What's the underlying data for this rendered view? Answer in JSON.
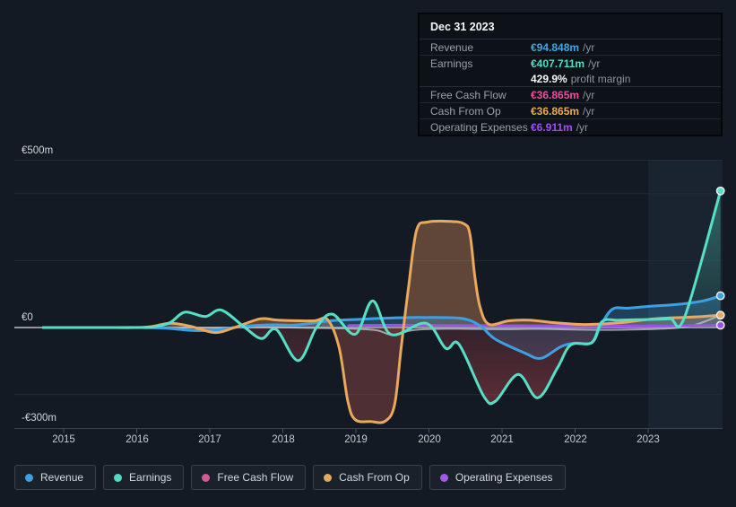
{
  "tooltip": {
    "date": "Dec 31 2023",
    "revenue": {
      "label": "Revenue",
      "value": "€94.848m",
      "suffix": "/yr"
    },
    "earnings": {
      "label": "Earnings",
      "value": "€407.711m",
      "suffix": "/yr"
    },
    "margin": {
      "value": "429.9%",
      "suffix": "profit margin"
    },
    "fcf": {
      "label": "Free Cash Flow",
      "value": "€36.865m",
      "suffix": "/yr"
    },
    "cfo": {
      "label": "Cash From Op",
      "value": "€36.865m",
      "suffix": "/yr"
    },
    "opex": {
      "label": "Operating Expenses",
      "value": "€6.911m",
      "suffix": "/yr"
    }
  },
  "legend": {
    "items": [
      {
        "label": "Revenue",
        "color": "#3da0e3"
      },
      {
        "label": "Earnings",
        "color": "#4fdcc2"
      },
      {
        "label": "Free Cash Flow",
        "color": "#cf5a95"
      },
      {
        "label": "Cash From Op",
        "color": "#e3a95e"
      },
      {
        "label": "Operating Expenses",
        "color": "#a259e8"
      }
    ]
  },
  "chart_data": {
    "type": "line",
    "unit": "EUR millions per year",
    "x_ticks": [
      2015,
      2016,
      2017,
      2018,
      2019,
      2020,
      2021,
      2022,
      2023
    ],
    "ylim": [
      -300,
      500
    ],
    "y_ticks": [
      {
        "label": "€500m",
        "value": 500
      },
      {
        "label": "€0",
        "value": 0
      },
      {
        "label": "-€300m",
        "value": -300
      }
    ],
    "gridline_values": [
      500,
      400,
      200,
      -200
    ],
    "highlight_from": 2023,
    "colors": {
      "zero_line": "#8f969e",
      "gridline": "#232b36",
      "axis": "#3a434f",
      "tick": "#49525f",
      "highlight_band": "#1d2a38",
      "dot_stroke": "#edf0f2"
    },
    "series": [
      {
        "name": "Revenue",
        "color": "#3da0e3",
        "kind": "revenue",
        "end_dot": true,
        "points": [
          [
            2014.72,
            0
          ],
          [
            2015.5,
            0
          ],
          [
            2016.1,
            0
          ],
          [
            2016.46,
            -3
          ],
          [
            2016.78,
            -9
          ],
          [
            2017.1,
            -7
          ],
          [
            2017.4,
            2
          ],
          [
            2017.7,
            7
          ],
          [
            2017.93,
            8
          ],
          [
            2018.2,
            8
          ],
          [
            2018.64,
            20
          ],
          [
            2019.0,
            24
          ],
          [
            2019.4,
            28
          ],
          [
            2019.9,
            30
          ],
          [
            2020.45,
            27
          ],
          [
            2020.7,
            5
          ],
          [
            2020.91,
            -35
          ],
          [
            2021.3,
            -75
          ],
          [
            2021.53,
            -92
          ],
          [
            2021.8,
            -58
          ],
          [
            2021.98,
            -47
          ],
          [
            2022.23,
            -45
          ],
          [
            2022.35,
            5
          ],
          [
            2022.51,
            55
          ],
          [
            2022.72,
            58
          ],
          [
            2023.0,
            63
          ],
          [
            2023.45,
            70
          ],
          [
            2023.76,
            80
          ],
          [
            2023.99,
            95
          ]
        ]
      },
      {
        "name": "Earnings",
        "color": "#55dfc5",
        "kind": "earnings",
        "end_dot": true,
        "points": [
          [
            2014.72,
            0
          ],
          [
            2015.5,
            0
          ],
          [
            2016.0,
            0
          ],
          [
            2016.21,
            1
          ],
          [
            2016.45,
            14
          ],
          [
            2016.66,
            46
          ],
          [
            2016.94,
            33
          ],
          [
            2017.16,
            52
          ],
          [
            2017.48,
            0
          ],
          [
            2017.71,
            -33
          ],
          [
            2017.91,
            -6
          ],
          [
            2018.21,
            -99
          ],
          [
            2018.46,
            0
          ],
          [
            2018.68,
            40
          ],
          [
            2018.99,
            -20
          ],
          [
            2019.23,
            80
          ],
          [
            2019.48,
            -21
          ],
          [
            2019.96,
            13
          ],
          [
            2020.23,
            -62
          ],
          [
            2020.41,
            -50
          ],
          [
            2020.75,
            -205
          ],
          [
            2020.91,
            -220
          ],
          [
            2021.22,
            -140
          ],
          [
            2021.49,
            -210
          ],
          [
            2021.76,
            -120
          ],
          [
            2021.94,
            -52
          ],
          [
            2022.23,
            -45
          ],
          [
            2022.37,
            18
          ],
          [
            2022.6,
            22
          ],
          [
            2023.0,
            24
          ],
          [
            2023.3,
            26
          ],
          [
            2023.5,
            32
          ],
          [
            2023.99,
            408
          ]
        ]
      },
      {
        "name": "Free Cash Flow",
        "color": "#b6bcc2",
        "kind": "plain",
        "end_dot": false,
        "points": [
          [
            2014.72,
            0
          ],
          [
            2016.0,
            0
          ],
          [
            2017.0,
            -1
          ],
          [
            2017.7,
            1
          ],
          [
            2018.4,
            -1
          ],
          [
            2018.9,
            -3
          ],
          [
            2019.28,
            -8
          ],
          [
            2019.5,
            -22
          ],
          [
            2019.77,
            -8
          ],
          [
            2020.1,
            -4
          ],
          [
            2020.5,
            -4
          ],
          [
            2021.0,
            -5
          ],
          [
            2021.5,
            -4
          ],
          [
            2022.0,
            -6
          ],
          [
            2022.5,
            -7
          ],
          [
            2023.0,
            -5
          ],
          [
            2023.45,
            0
          ],
          [
            2023.7,
            12
          ],
          [
            2023.99,
            37
          ]
        ]
      },
      {
        "name": "Cash From Op",
        "color": "#e9a85b",
        "kind": "cfo",
        "end_dot": true,
        "points": [
          [
            2014.72,
            0
          ],
          [
            2015.5,
            0
          ],
          [
            2016.0,
            0
          ],
          [
            2016.21,
            3
          ],
          [
            2016.46,
            13
          ],
          [
            2016.73,
            4
          ],
          [
            2017.07,
            -15
          ],
          [
            2017.34,
            0
          ],
          [
            2017.69,
            26
          ],
          [
            2017.93,
            22
          ],
          [
            2018.42,
            20
          ],
          [
            2018.61,
            24
          ],
          [
            2018.77,
            -60
          ],
          [
            2018.89,
            -220
          ],
          [
            2018.99,
            -275
          ],
          [
            2019.2,
            -281
          ],
          [
            2019.4,
            -280
          ],
          [
            2019.53,
            -230
          ],
          [
            2019.62,
            -60
          ],
          [
            2019.72,
            120
          ],
          [
            2019.83,
            290
          ],
          [
            2019.98,
            315
          ],
          [
            2020.3,
            317
          ],
          [
            2020.48,
            310
          ],
          [
            2020.56,
            280
          ],
          [
            2020.63,
            150
          ],
          [
            2020.7,
            60
          ],
          [
            2020.82,
            10
          ],
          [
            2021.09,
            20
          ],
          [
            2021.37,
            22
          ],
          [
            2021.74,
            14
          ],
          [
            2022.16,
            9
          ],
          [
            2022.6,
            14
          ],
          [
            2023.09,
            26
          ],
          [
            2023.58,
            31
          ],
          [
            2023.99,
            37
          ]
        ]
      },
      {
        "name": "Operating Expenses",
        "color": "#9a51ea",
        "kind": "plain",
        "end_dot": true,
        "points": [
          [
            2018.9,
            6
          ],
          [
            2019.5,
            7
          ],
          [
            2020.5,
            6
          ],
          [
            2021.5,
            5
          ],
          [
            2022.5,
            4
          ],
          [
            2023.2,
            5
          ],
          [
            2023.99,
            7
          ]
        ]
      }
    ]
  }
}
